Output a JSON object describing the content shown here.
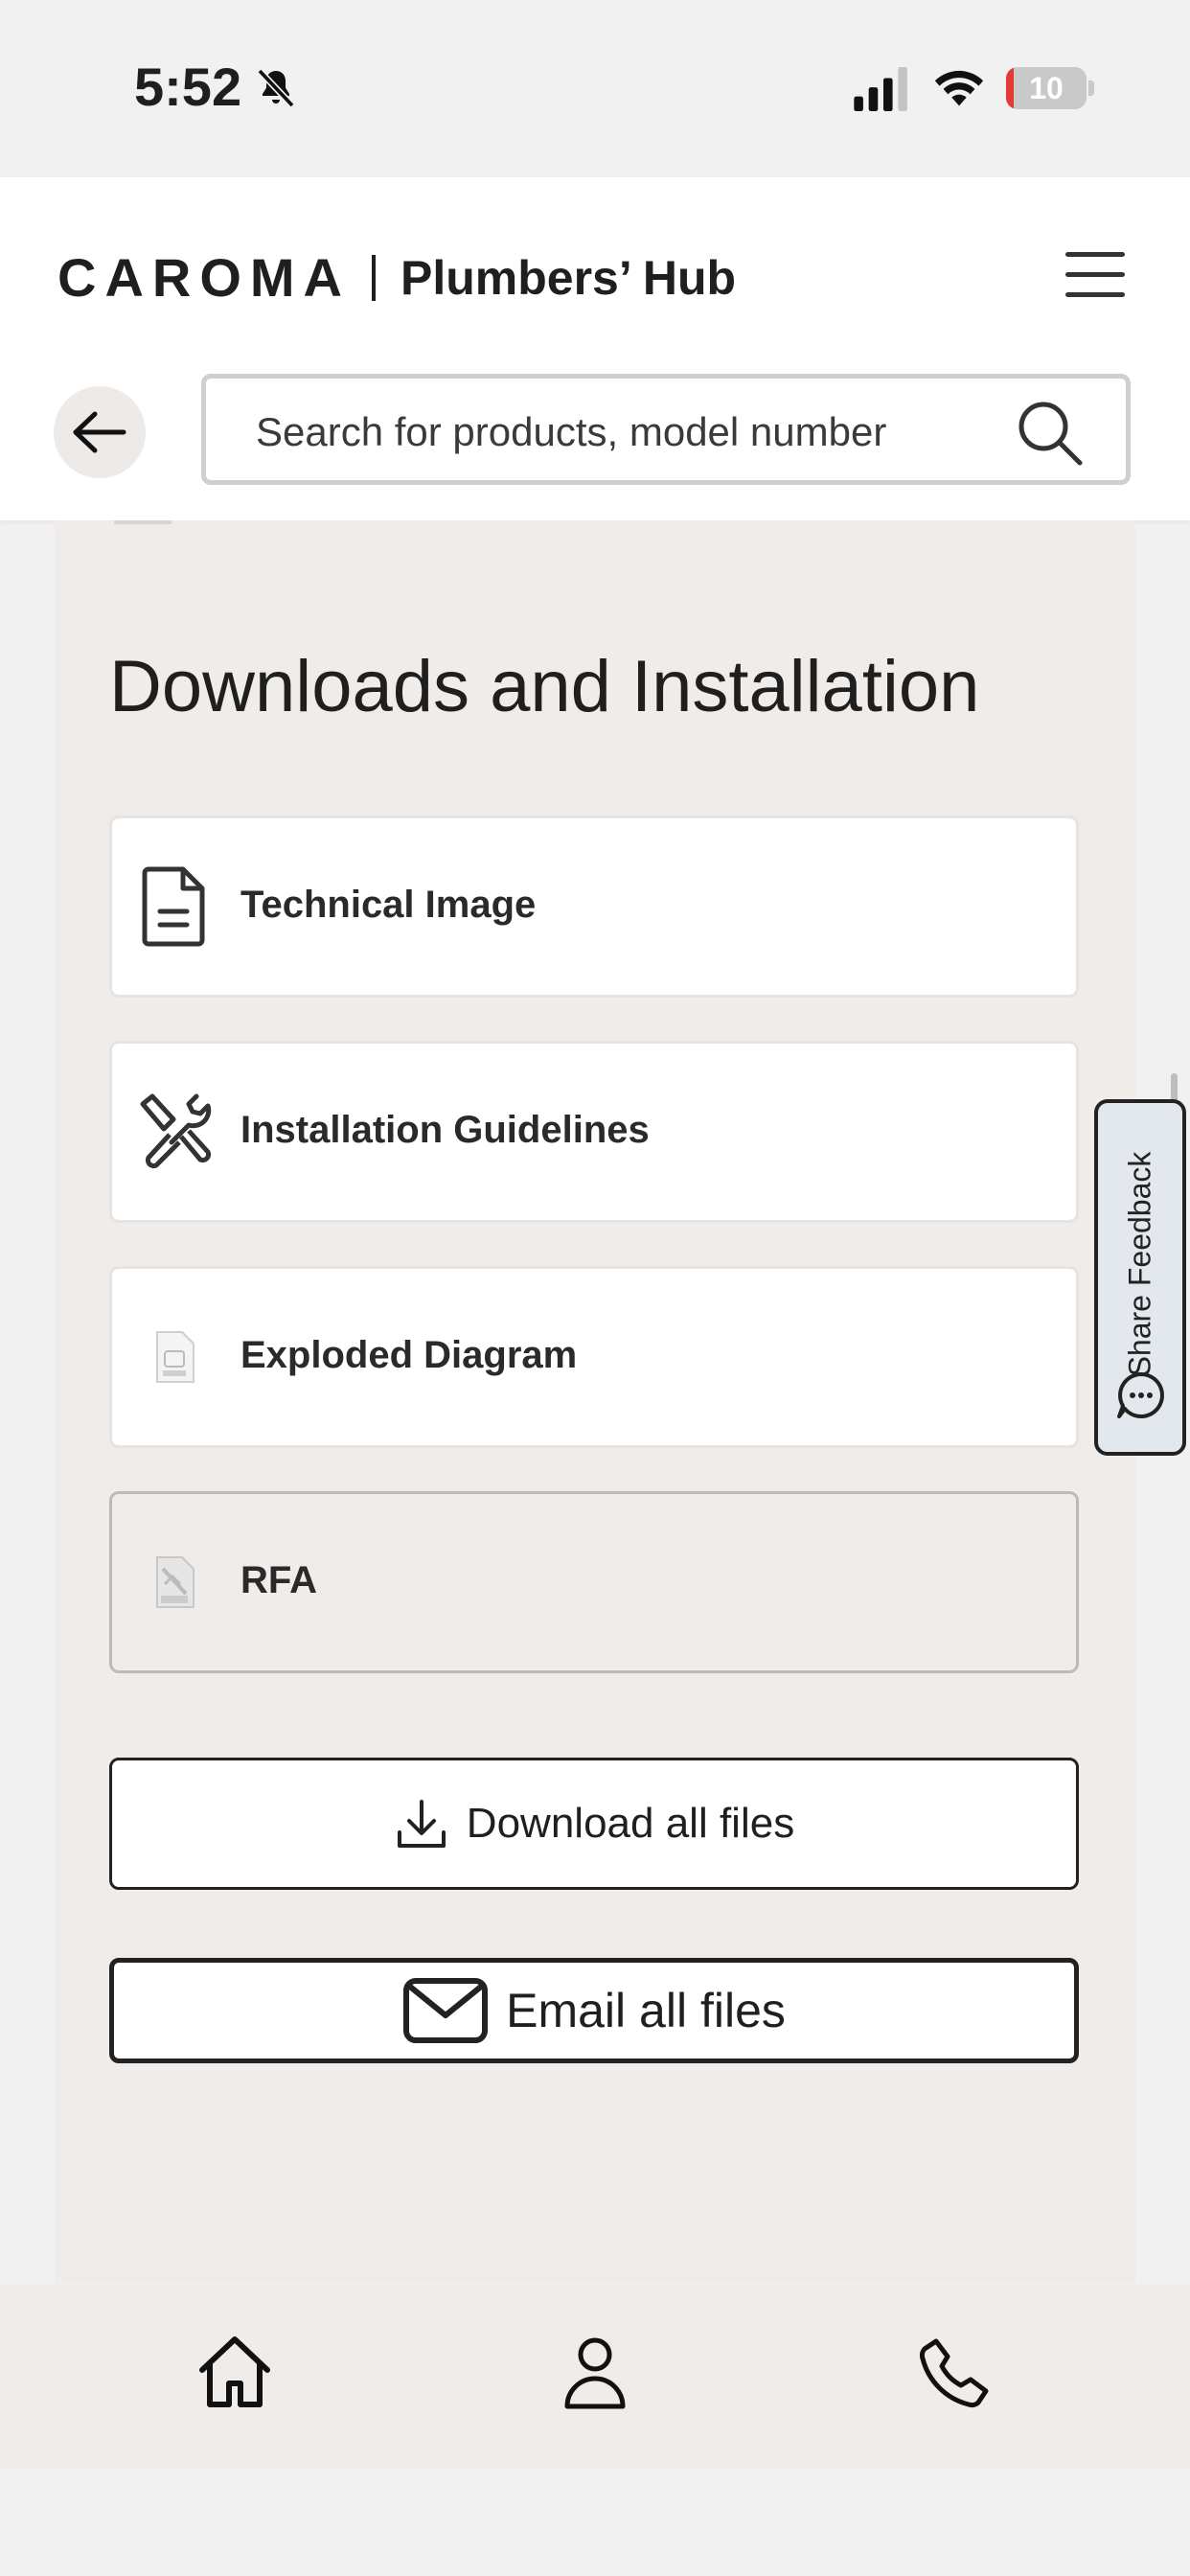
{
  "status_bar": {
    "time": "5:52",
    "battery": "10",
    "battery_level": 0.1
  },
  "header": {
    "brand_name": "CAROMA",
    "brand_sub": "Plumbers’ Hub",
    "search_placeholder": "Search for products, model number"
  },
  "section": {
    "title": "Downloads and Installation",
    "items": [
      {
        "label": "Technical Image",
        "icon": "document-icon",
        "enabled": true
      },
      {
        "label": "Installation Guidelines",
        "icon": "tools-icon",
        "enabled": true
      },
      {
        "label": "Exploded Diagram",
        "icon": "file-thumbnail-icon",
        "enabled": true
      },
      {
        "label": "RFA",
        "icon": "rfa-file-icon",
        "enabled": false
      }
    ],
    "download_all_label": "Download all files",
    "email_all_label": "Email all files"
  },
  "feedback": {
    "label": "Share Feedback"
  },
  "bottom_nav": {
    "items": [
      "home-icon",
      "account-icon",
      "phone-icon"
    ]
  }
}
